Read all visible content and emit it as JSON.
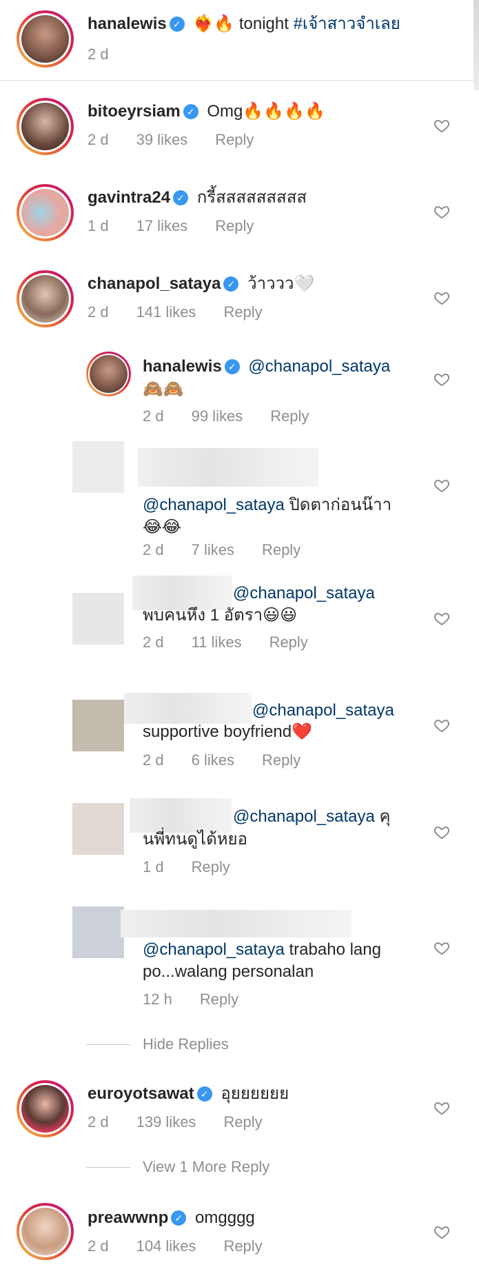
{
  "caption": {
    "username": "hanalewis",
    "text_before_emoji": "",
    "emoji": "❤‍🔥🔥",
    "text": "tonight",
    "hashtag": "#เจ้าสาวจำเลย",
    "time": "2 d"
  },
  "comments": [
    {
      "username": "bitoeyrsiam",
      "text": "Omg🔥🔥🔥🔥",
      "time": "2 d",
      "likes": "39 likes",
      "reply": "Reply"
    },
    {
      "username": "gavintra24",
      "text": "กรี้สสสสสสสสส",
      "time": "1 d",
      "likes": "17 likes",
      "reply": "Reply"
    },
    {
      "username": "chanapol_sataya",
      "text": "ว้าววว🤍",
      "time": "2 d",
      "likes": "141 likes",
      "reply": "Reply"
    },
    {
      "username": "euroyotsawat",
      "text": "อุยยยยยย",
      "time": "2 d",
      "likes": "139 likes",
      "reply": "Reply"
    },
    {
      "username": "preawwnp",
      "text": "omgggg",
      "time": "2 d",
      "likes": "104 likes",
      "reply": "Reply"
    }
  ],
  "replies": [
    {
      "username": "hanalewis",
      "mention": "@chanapol_sataya",
      "text": "🙈🙈",
      "time": "2 d",
      "likes": "99 likes",
      "reply": "Reply"
    },
    {
      "mention": "@chanapol_sataya",
      "text": "ปิดตาก่อนน๊าา",
      "text2": "😂😂",
      "time": "2 d",
      "likes": "7 likes",
      "reply": "Reply"
    },
    {
      "mention": "@chanapol_sataya",
      "text": "พบคนหึง 1 อัตรา😃😃",
      "time": "2 d",
      "likes": "11 likes",
      "reply": "Reply"
    },
    {
      "mention": "@chanapol_sataya",
      "text": "supportive boyfriend❤️",
      "time": "2 d",
      "likes": "6 likes",
      "reply": "Reply"
    },
    {
      "mention": "@chanapol_sataya",
      "text_inline": "คุ",
      "text": "นพี่ทนดูได้หยอ",
      "time": "1 d",
      "reply": "Reply"
    },
    {
      "mention": "@chanapol_sataya",
      "text_inline": "trabaho lang",
      "text": "po...walang personalan",
      "time": "12 h",
      "reply": "Reply"
    }
  ],
  "hide_replies": "Hide Replies",
  "view_more": "View 1 More Reply",
  "icons": {
    "verified": "verified-badge-icon",
    "heart": "heart-outline-icon"
  },
  "colors": {
    "mention": "#00376b",
    "meta": "#8e8e8e",
    "verified": "#3897f0"
  }
}
